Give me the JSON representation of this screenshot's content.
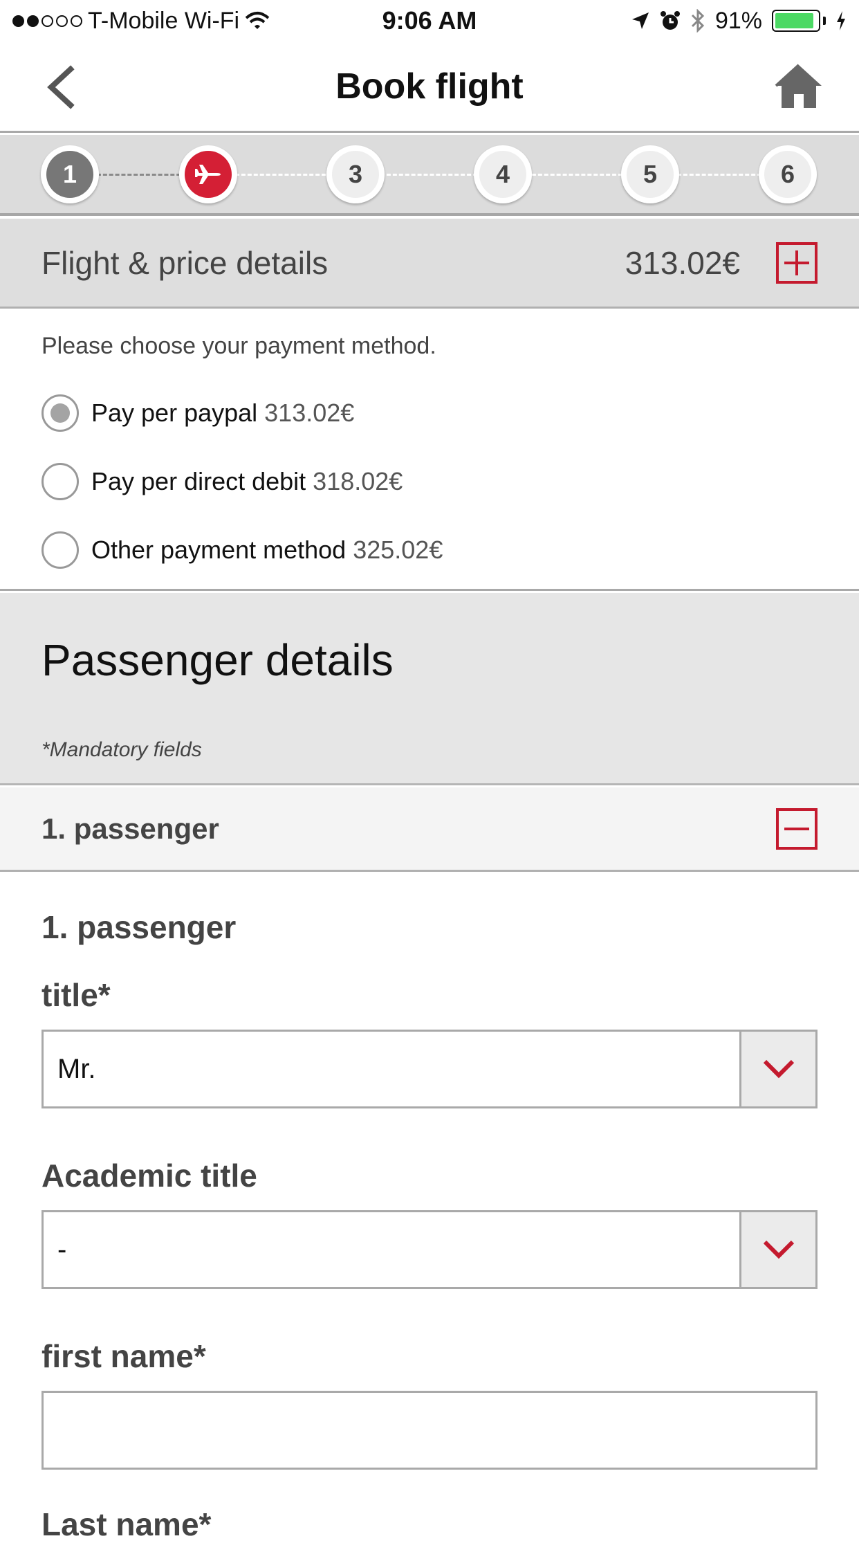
{
  "status_bar": {
    "carrier": "T-Mobile Wi-Fi",
    "time": "9:06 AM",
    "battery": "91%",
    "battery_level": 0.91,
    "icons": [
      "signal-dots-icon",
      "wifi-icon",
      "location-icon",
      "alarm-icon",
      "bluetooth-icon",
      "battery-icon",
      "charging-icon"
    ]
  },
  "nav": {
    "title": "Book flight",
    "back_icon": "chevron-left-icon",
    "home_icon": "home-icon"
  },
  "stepper": {
    "steps": [
      {
        "label": "1",
        "state": "done"
      },
      {
        "label": "",
        "state": "active",
        "icon": "airplane-icon"
      },
      {
        "label": "3",
        "state": "pending"
      },
      {
        "label": "4",
        "state": "pending"
      },
      {
        "label": "5",
        "state": "pending"
      },
      {
        "label": "6",
        "state": "pending"
      }
    ]
  },
  "price": {
    "label": "Flight & price details",
    "amount": "313.02€",
    "toggle_icon": "plus-box-icon"
  },
  "payment": {
    "prompt": "Please choose your payment method.",
    "options": [
      {
        "name": "Pay per paypal",
        "price": "313.02€",
        "selected": true
      },
      {
        "name": "Pay per direct debit",
        "price": "318.02€",
        "selected": false
      },
      {
        "name": "Other payment method",
        "price": "325.02€",
        "selected": false
      }
    ]
  },
  "passenger_details": {
    "title": "Passenger details",
    "mandatory_note": "*Mandatory fields"
  },
  "passenger_accordion": {
    "label": "1. passenger",
    "toggle_icon": "minus-box-icon"
  },
  "form": {
    "heading": "1. passenger",
    "title_label": "title*",
    "title_value": "Mr.",
    "academic_label": "Academic title",
    "academic_value": "-",
    "first_name_label": "first name*",
    "first_name_value": "",
    "last_name_label": "Last name*"
  },
  "colors": {
    "accent": "#d41f35",
    "section_bg": "#dedede"
  }
}
